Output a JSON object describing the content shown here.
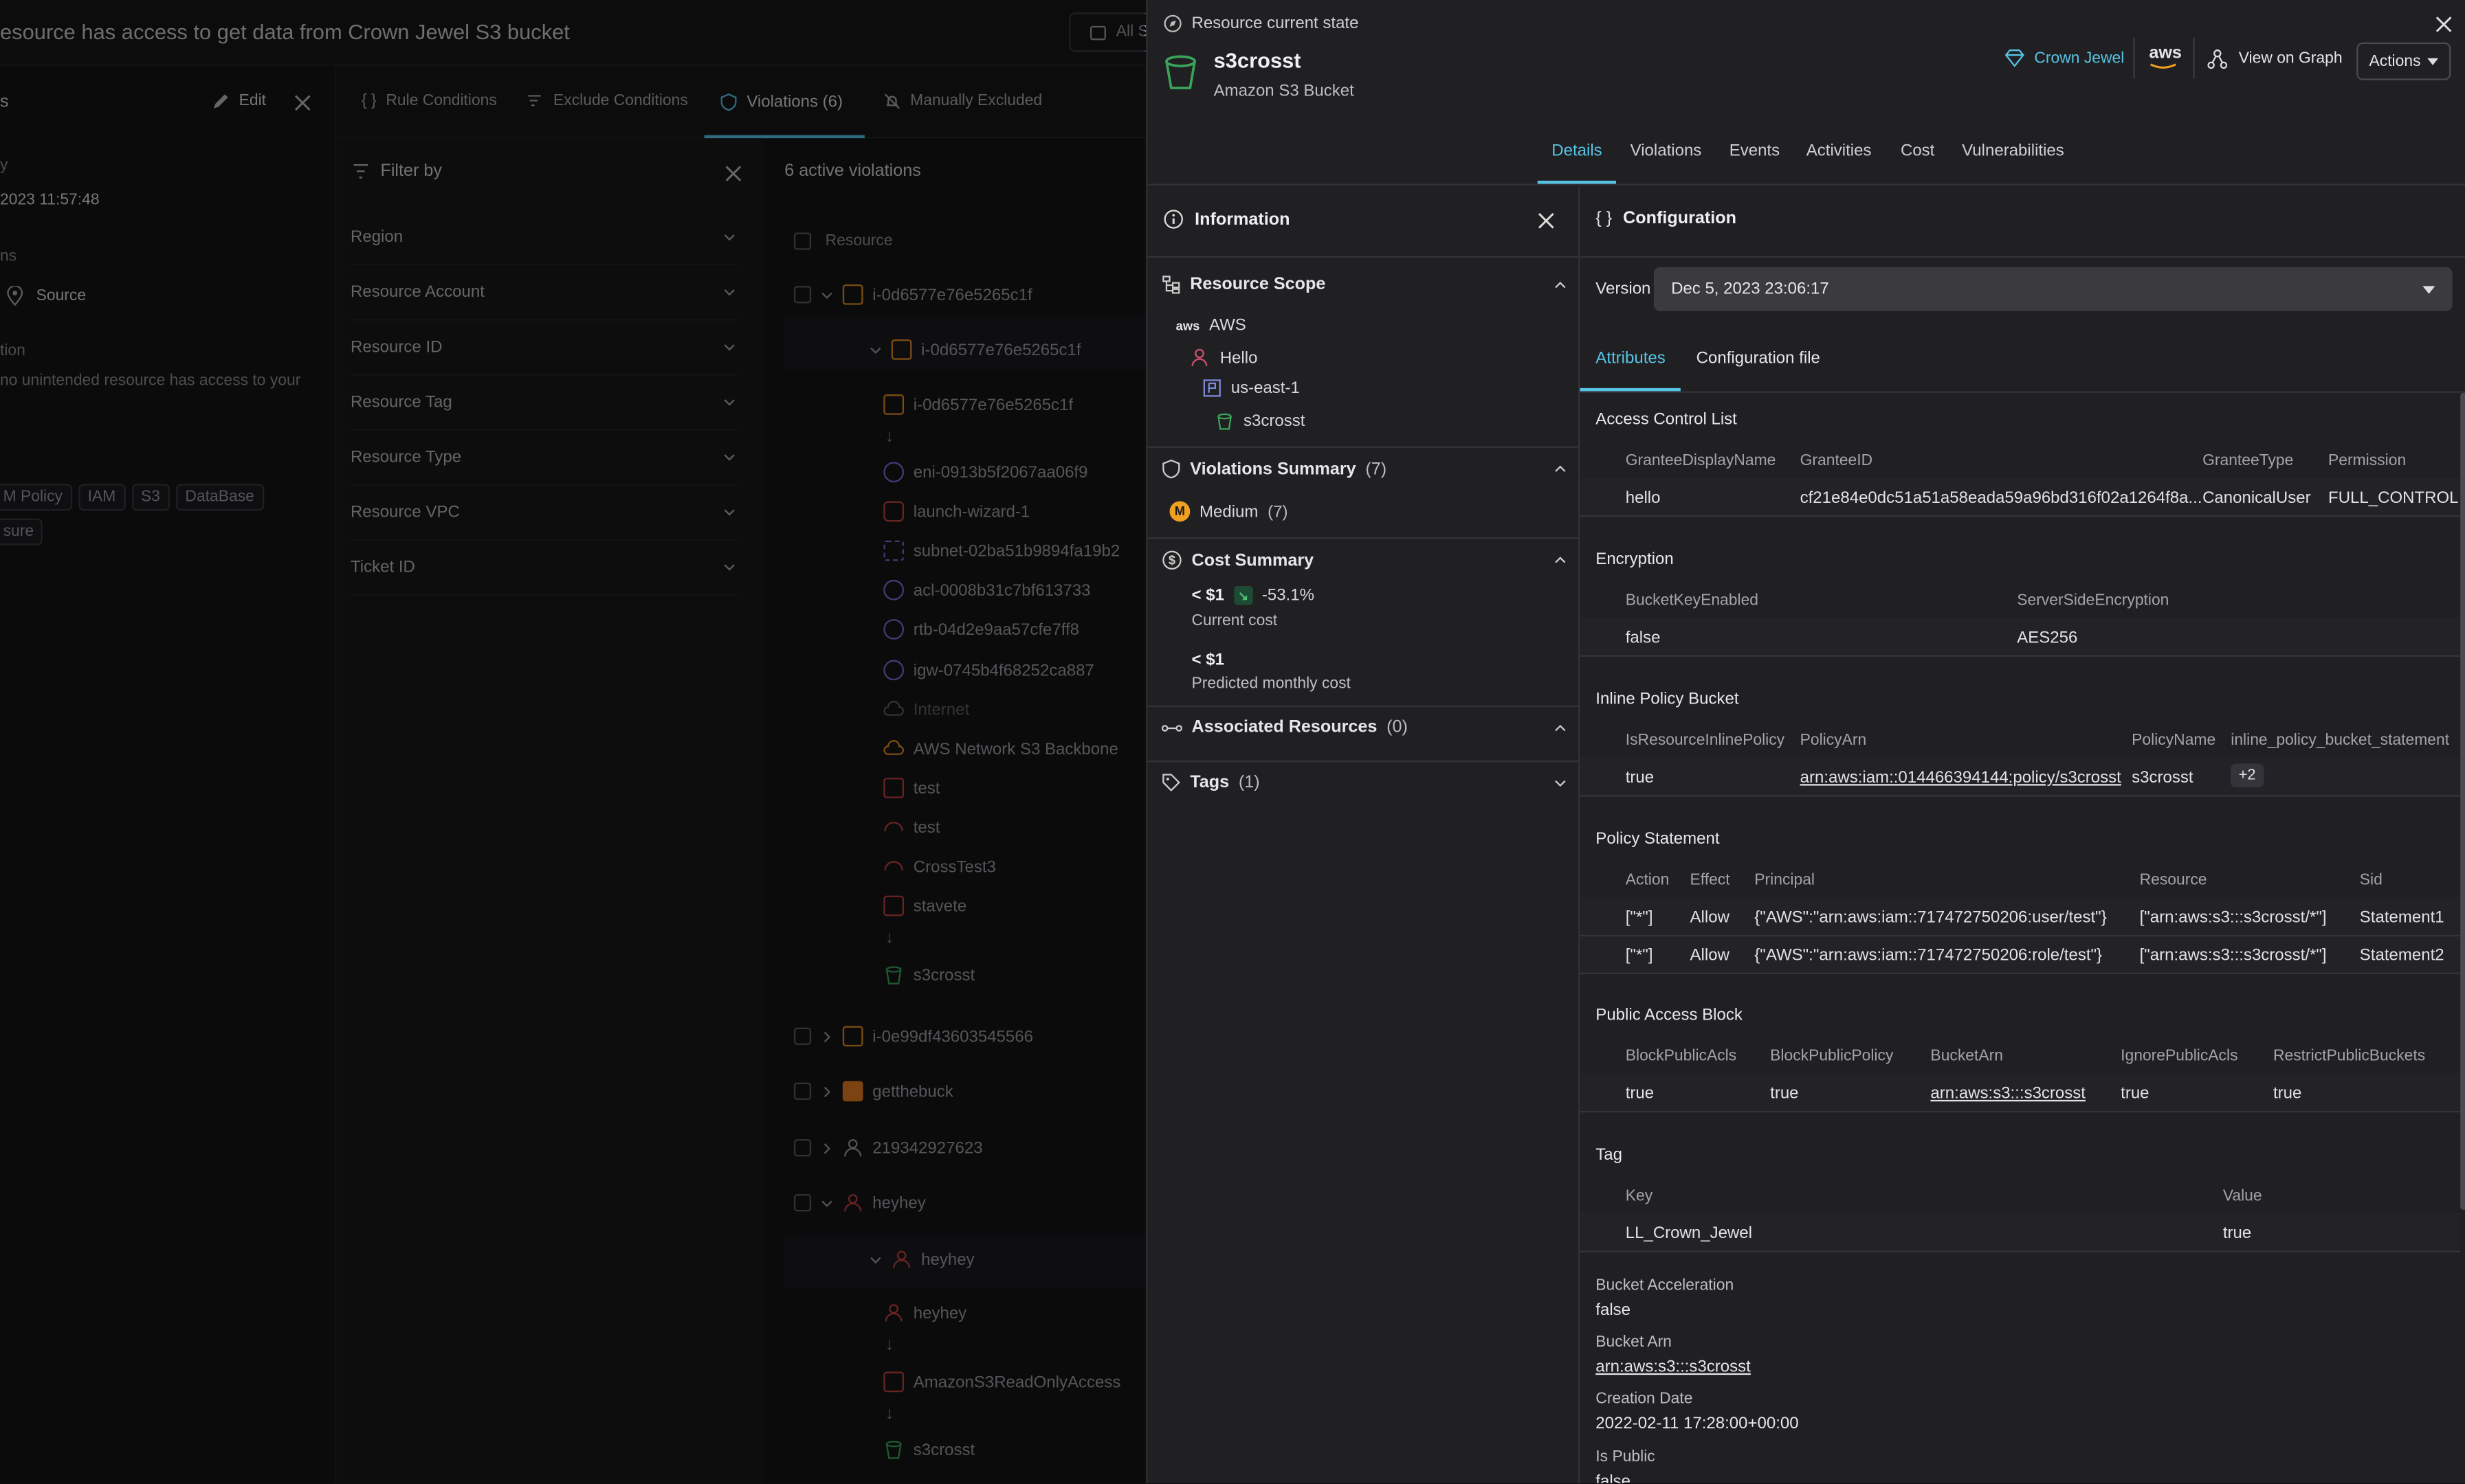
{
  "bg": {
    "title": "esource has access to get data from Crown Jewel S3 bucket",
    "all_button": "All S",
    "rule": {
      "s_label": "s",
      "edit": "Edit",
      "y_label": "y",
      "date": "2023 11:57:48",
      "ns_label": "ns",
      "source": "Source",
      "tion_label": "tion",
      "desc": "no unintended resource has access to your",
      "tags": [
        "M Policy",
        "IAM",
        "S3",
        "DataBase"
      ],
      "sure": "sure"
    },
    "tabs": [
      "Rule Conditions",
      "Exclude Conditions",
      "Violations (6)",
      "Manually Excluded"
    ],
    "filter": {
      "title": "Filter by",
      "rows": [
        "Region",
        "Resource Account",
        "Resource ID",
        "Resource Tag",
        "Resource Type",
        "Resource VPC",
        "Ticket ID"
      ]
    },
    "list": {
      "count": "6 active violations",
      "header": "Resource",
      "items": [
        "i-0d6577e76e5265c1f",
        "i-0d6577e76e5265c1f",
        "i-0d6577e76e5265c1f",
        "eni-0913b5f2067aa06f9",
        "launch-wizard-1",
        "subnet-02ba51b9894fa19b2",
        "acl-0008b31c7bf613733",
        "rtb-04d2e9aa57cfe7ff8",
        "igw-0745b4f68252ca887",
        "Internet",
        "AWS Network S3 Backbone",
        "test",
        "test",
        "CrossTest3",
        "stavete",
        "s3crosst",
        "i-0e99df43603545566",
        "getthebuck",
        "219342927623",
        "heyhey",
        "heyhey",
        "heyhey",
        "AmazonS3ReadOnlyAccess",
        "s3crosst"
      ]
    }
  },
  "drawer": {
    "state_label": "Resource current state",
    "name": "s3crosst",
    "type": "Amazon S3 Bucket",
    "crown_jewel": "Crown Jewel",
    "aws": "aws",
    "view_graph": "View on Graph",
    "actions": "Actions",
    "tabs": [
      "Details",
      "Violations",
      "Events",
      "Activities",
      "Cost",
      "Vulnerabilities"
    ],
    "info": {
      "title": "Information",
      "scope": {
        "title": "Resource Scope",
        "items": [
          "AWS",
          "Hello",
          "us-east-1",
          "s3crosst"
        ]
      },
      "violations": {
        "title": "Violations Summary",
        "count": "(7)",
        "badge": "M",
        "label": "Medium",
        "label_count": "(7)"
      },
      "cost": {
        "title": "Cost Summary",
        "current_value": "< $1",
        "change": "-53.1%",
        "current_label": "Current cost",
        "predicted_value": "< $1",
        "predicted_label": "Predicted monthly cost"
      },
      "associated": {
        "title": "Associated Resources",
        "count": "(0)"
      },
      "tags": {
        "title": "Tags",
        "count": "(1)"
      }
    },
    "config": {
      "title": "Configuration",
      "version_label": "Version",
      "version_value": "Dec 5, 2023 23:06:17",
      "subtabs": [
        "Attributes",
        "Configuration file"
      ],
      "acl": {
        "title": "Access Control List",
        "headers": [
          "GranteeDisplayName",
          "GranteeID",
          "GranteeType",
          "Permission"
        ],
        "row": [
          "hello",
          "cf21e84e0dc51a51a58eada59a96bd316f02a1264f8a...",
          "CanonicalUser",
          "FULL_CONTROL"
        ]
      },
      "encryption": {
        "title": "Encryption",
        "headers": [
          "BucketKeyEnabled",
          "ServerSideEncryption"
        ],
        "row": [
          "false",
          "AES256"
        ]
      },
      "inline": {
        "title": "Inline Policy Bucket",
        "headers": [
          "IsResourceInlinePolicy",
          "PolicyArn",
          "PolicyName",
          "inline_policy_bucket_statement"
        ],
        "row": [
          "true",
          "arn:aws:iam::014466394144:policy/s3crosst",
          "s3crosst",
          "+2"
        ]
      },
      "policy": {
        "title": "Policy Statement",
        "headers": [
          "Action",
          "Effect",
          "Principal",
          "Resource",
          "Sid"
        ],
        "rows": [
          [
            "[\"*\"]",
            "Allow",
            "{\"AWS\":\"arn:aws:iam::717472750206:user/test\"}",
            "[\"arn:aws:s3:::s3crosst/*\"]",
            "Statement1"
          ],
          [
            "[\"*\"]",
            "Allow",
            "{\"AWS\":\"arn:aws:iam::717472750206:role/test\"}",
            "[\"arn:aws:s3:::s3crosst/*\"]",
            "Statement2"
          ]
        ]
      },
      "pab": {
        "title": "Public Access Block",
        "headers": [
          "BlockPublicAcls",
          "BlockPublicPolicy",
          "BucketArn",
          "IgnorePublicAcls",
          "RestrictPublicBuckets"
        ],
        "row": [
          "true",
          "true",
          "arn:aws:s3:::s3crosst",
          "true",
          "true"
        ]
      },
      "tag": {
        "title": "Tag",
        "headers": [
          "Key",
          "Value"
        ],
        "row": [
          "LL_Crown_Jewel",
          "true"
        ]
      },
      "props": [
        {
          "label": "Bucket Acceleration",
          "value": "false"
        },
        {
          "label": "Bucket Arn",
          "value": "arn:aws:s3:::s3crosst"
        },
        {
          "label": "Creation Date",
          "value": "2022-02-11 17:28:00+00:00"
        },
        {
          "label": "Is Public",
          "value": "false"
        }
      ]
    }
  },
  "colors": {
    "accent": "#57c4e5",
    "medium": "#f0a020",
    "bucket": "#3aa35a",
    "background": "#141416",
    "drawer": "#202023"
  }
}
